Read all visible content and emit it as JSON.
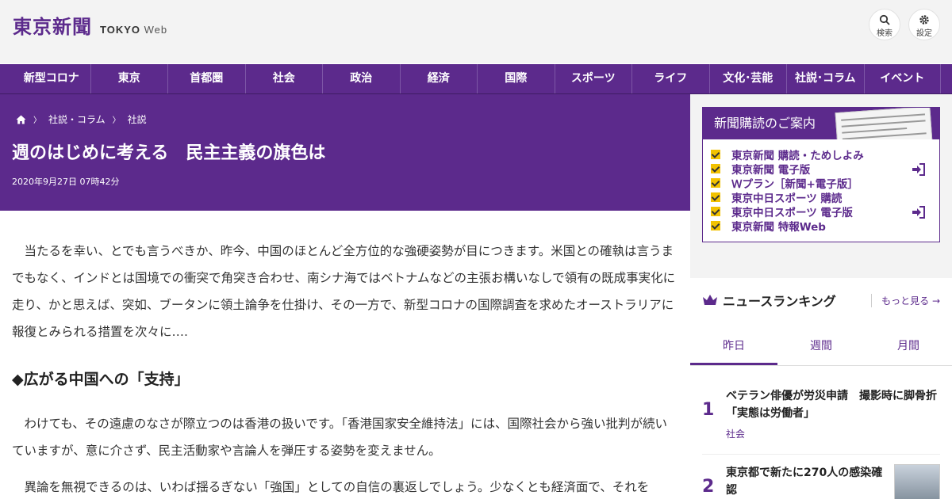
{
  "header": {
    "logo_jp": "東京新聞",
    "logo_en_bold": "TOKYO",
    "logo_en": "Web",
    "search_label": "検索",
    "settings_label": "設定"
  },
  "nav": {
    "items": [
      "新型コロナ",
      "東京",
      "首都圏",
      "社会",
      "政治",
      "経済",
      "国際",
      "スポーツ",
      "ライフ",
      "文化･芸能",
      "社説･コラム",
      "イベント"
    ]
  },
  "article": {
    "breadcrumb": [
      "社説・コラム",
      "社説"
    ],
    "title": "週のはじめに考える　民主主義の旗色は",
    "date": "2020年9月27日 07時42分",
    "para1": "当たるを幸い、とでも言うべきか、昨今、中国のほとんど全方位的な強硬姿勢が目につきます。米国との確執は言うまでもなく、インドとは国境での衝突で角突き合わせ、南シナ海ではベトナムなどの主張お構いなしで領有の既成事実化に走り、かと思えば、突如、ブータンに領土論争を仕掛け、その一方で、新型コロナの国際調査を求めたオーストラリアに報復とみられる措置を次々に….",
    "heading": "◆広がる中国への「支持」",
    "para2": "わけても、その遠慮のなさが際立つのは香港の扱いです。「香港国家安全維持法」には、国際社会から強い批判が続いていますが、意に介さず、民主活動家や言論人を弾圧する姿勢を変えません。",
    "para3": "異論を無視できるのは、いわば揺るぎない「強国」としての自信の裏返しでしょう。少なくとも経済面で、それを"
  },
  "sidebar": {
    "subscribe_title": "新聞購読のご案内",
    "subscribe_links": [
      "東京新聞 購読・ためしよみ",
      "東京新聞 電子版",
      "Ｗプラン［新聞+電子版］",
      "東京中日スポーツ 購読",
      "東京中日スポーツ 電子版",
      "東京新聞 特報Web"
    ],
    "ranking_title": "ニュースランキング",
    "more_label": "もっと見る",
    "tabs": [
      "昨日",
      "週間",
      "月間"
    ],
    "ranking": [
      {
        "rank": "1",
        "title_line1": "ベテラン俳優が労災申請　撮影時に脚骨折",
        "title_line2": "「実態は労働者」",
        "category": "社会"
      },
      {
        "rank": "2",
        "title_line1": "東京都で新たに270人の感染確",
        "title_line2": "認"
      }
    ]
  },
  "colors": {
    "brand": "#5c2a8c",
    "accent": "#f2c200"
  },
  "icons": [
    "search-icon",
    "gear-icon",
    "home-icon",
    "chevron-right-icon",
    "login-icon",
    "crown-icon",
    "arrow-right-icon",
    "check-icon"
  ]
}
